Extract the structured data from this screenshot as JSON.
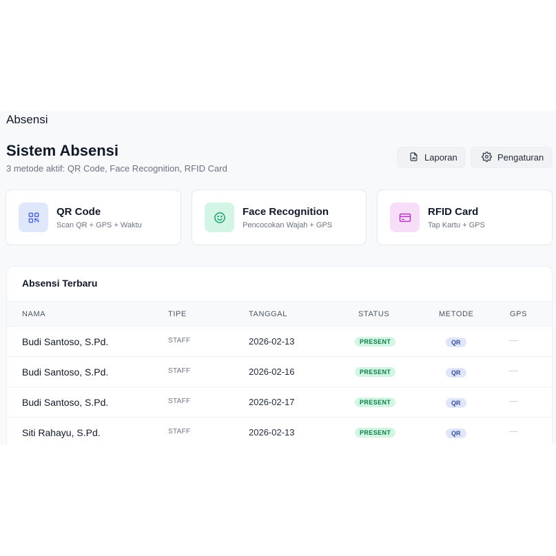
{
  "page": {
    "heading": "Absensi",
    "title": "Sistem Absensi",
    "subtitle": "3 metode aktif: QR Code, Face Recognition, RFID Card"
  },
  "actions": {
    "report_label": "Laporan",
    "settings_label": "Pengaturan"
  },
  "methods": [
    {
      "title": "QR Code",
      "desc": "Scan QR + GPS + Waktu",
      "icon": "qr-code-icon",
      "color": "#4f6ad8"
    },
    {
      "title": "Face Recognition",
      "desc": "Pencocokan Wajah + GPS",
      "icon": "smile-face-icon",
      "color": "#17a06b"
    },
    {
      "title": "RFID Card",
      "desc": "Tap Kartu + GPS",
      "icon": "credit-card-icon",
      "color": "#b536c5"
    }
  ],
  "recent": {
    "title": "Absensi Terbaru",
    "columns": [
      "NAMA",
      "TIPE",
      "TANGGAL",
      "STATUS",
      "METODE",
      "GPS"
    ],
    "rows": [
      {
        "name": "Budi Santoso, S.Pd.",
        "type": "STAFF",
        "date": "2026-02-13",
        "status": "PRESENT",
        "method": "QR",
        "gps": "—"
      },
      {
        "name": "Budi Santoso, S.Pd.",
        "type": "STAFF",
        "date": "2026-02-16",
        "status": "PRESENT",
        "method": "QR",
        "gps": "—"
      },
      {
        "name": "Budi Santoso, S.Pd.",
        "type": "STAFF",
        "date": "2026-02-17",
        "status": "PRESENT",
        "method": "QR",
        "gps": "—"
      },
      {
        "name": "Siti Rahayu, S.Pd.",
        "type": "STAFF",
        "date": "2026-02-13",
        "status": "PRESENT",
        "method": "QR",
        "gps": "—"
      }
    ]
  },
  "colors": {
    "status_present_bg": "#d1f7e4",
    "status_present_text": "#0f7a46",
    "method_badge_bg": "#dfe6f9",
    "method_badge_text": "#3b4f9c"
  }
}
